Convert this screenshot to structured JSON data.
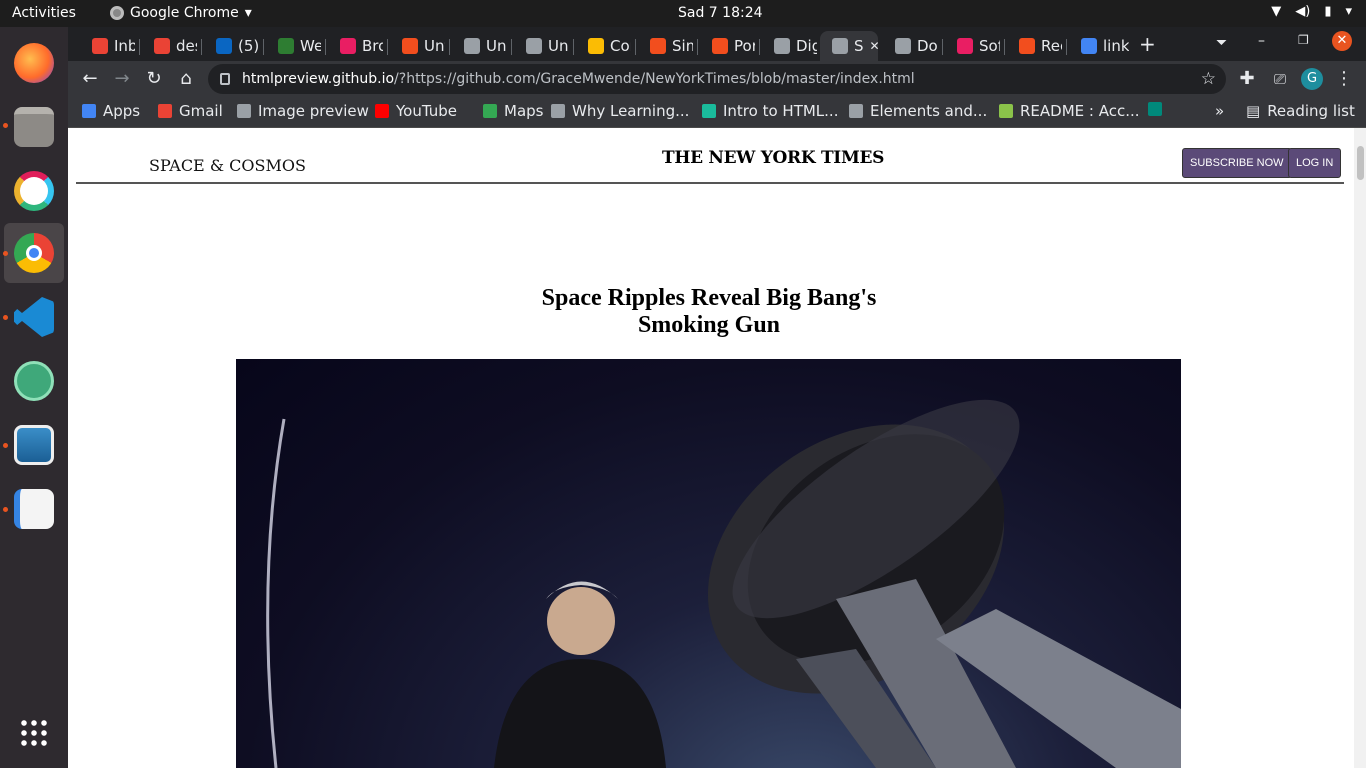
{
  "topbar": {
    "activities": "Activities",
    "app_name": "Google Chrome",
    "clock": "Sad 7  18:24"
  },
  "tabs": [
    {
      "label": "Inb",
      "color": "#ea4335"
    },
    {
      "label": "des",
      "color": "#ea4335"
    },
    {
      "label": "(5)",
      "color": "#0a66c2"
    },
    {
      "label": "We",
      "color": "#2e7d32"
    },
    {
      "label": "Bro",
      "color": "#e91e63"
    },
    {
      "label": "Unt",
      "color": "#f24e1e"
    },
    {
      "label": "Uni",
      "color": "#9aa0a6"
    },
    {
      "label": "Uni",
      "color": "#9aa0a6"
    },
    {
      "label": "Cor",
      "color": "#fbbc04"
    },
    {
      "label": "Sim",
      "color": "#f24e1e"
    },
    {
      "label": "Por",
      "color": "#f24e1e"
    },
    {
      "label": "Dig",
      "color": "#9aa0a6"
    },
    {
      "label": "S",
      "color": "#9aa0a6"
    },
    {
      "label": "Do",
      "color": "#9aa0a6"
    },
    {
      "label": "Sof",
      "color": "#e91e63"
    },
    {
      "label": "Rec",
      "color": "#f24e1e"
    },
    {
      "label": "link",
      "color": "#4285f4"
    }
  ],
  "address": {
    "host": "htmlpreview.github.io",
    "rest": "/?https://github.com/GraceMwende/NewYorkTimes/blob/master/index.html"
  },
  "bookmarks": [
    {
      "label": "Apps",
      "color": "#4285f4"
    },
    {
      "label": "Gmail",
      "color": "#ea4335"
    },
    {
      "label": "Image preview",
      "color": "#9aa0a6"
    },
    {
      "label": "YouTube",
      "color": "#ff0000"
    },
    {
      "label": "Maps",
      "color": "#34a853"
    },
    {
      "label": "Why Learning...",
      "color": "#9aa0a6"
    },
    {
      "label": "Intro to HTML...",
      "color": "#1abc9c"
    },
    {
      "label": "Elements and...",
      "color": "#9aa0a6"
    },
    {
      "label": "README : Acc...",
      "color": "#8bc34a"
    },
    {
      "label": "",
      "color": "#00897b"
    }
  ],
  "reading_list": "Reading list",
  "site": {
    "section": "SPACE & COSMOS",
    "masthead": "THE NEW YORK TIMES",
    "subscribe": "SUBSCRIBE NOW",
    "login": "LOG IN",
    "headline_line1": "Space Ripples Reveal Big Bang's",
    "headline_line2": "Smoking Gun"
  }
}
